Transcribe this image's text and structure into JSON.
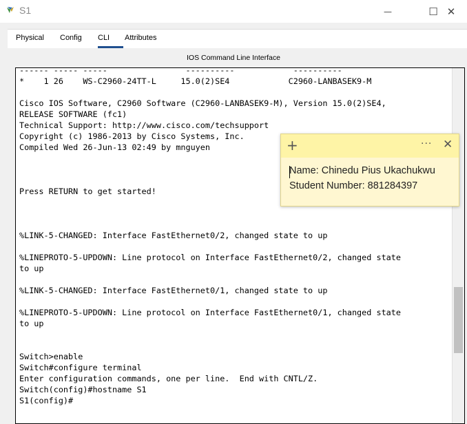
{
  "window": {
    "title": "S1",
    "minimize_glyph": "—",
    "maximize_glyph": "☐",
    "close_glyph": "✕"
  },
  "tabs": [
    {
      "label": "Physical"
    },
    {
      "label": "Config"
    },
    {
      "label": "CLI"
    },
    {
      "label": "Attributes"
    }
  ],
  "active_tab": "CLI",
  "cli": {
    "title": "IOS Command Line Interface",
    "lines": [
      "------ ----- -----                ----------            ----------",
      "*    1 26    WS-C2960-24TT-L     15.0(2)SE4            C2960-LANBASEK9-M",
      "",
      "Cisco IOS Software, C2960 Software (C2960-LANBASEK9-M), Version 15.0(2)SE4,",
      "RELEASE SOFTWARE (fc1)",
      "Technical Support: http://www.cisco.com/techsupport",
      "Copyright (c) 1986-2013 by Cisco Systems, Inc.",
      "Compiled Wed 26-Jun-13 02:49 by mnguyen",
      "",
      "",
      "",
      "Press RETURN to get started!",
      "",
      "",
      "",
      "%LINK-5-CHANGED: Interface FastEthernet0/2, changed state to up",
      "",
      "%LINEPROTO-5-UPDOWN: Line protocol on Interface FastEthernet0/2, changed state",
      "to up",
      "",
      "%LINK-5-CHANGED: Interface FastEthernet0/1, changed state to up",
      "",
      "%LINEPROTO-5-UPDOWN: Line protocol on Interface FastEthernet0/1, changed state",
      "to up",
      "",
      "",
      "Switch>enable",
      "Switch#configure terminal",
      "Enter configuration commands, one per line.  End with CNTL/Z.",
      "Switch(config)#hostname S1",
      "S1(config)#"
    ]
  },
  "sticky_note": {
    "add_glyph": "+",
    "more_glyph": "···",
    "close_glyph": "✕",
    "lines": [
      "Name: Chinedu Pius Ukachukwu",
      "Student Number: 881284397"
    ],
    "background_color": "#fff7d1",
    "header_color": "#fef4a6"
  },
  "colors": {
    "tab_accent": "#1f4f8f",
    "terminal_bg": "#ffffff"
  }
}
